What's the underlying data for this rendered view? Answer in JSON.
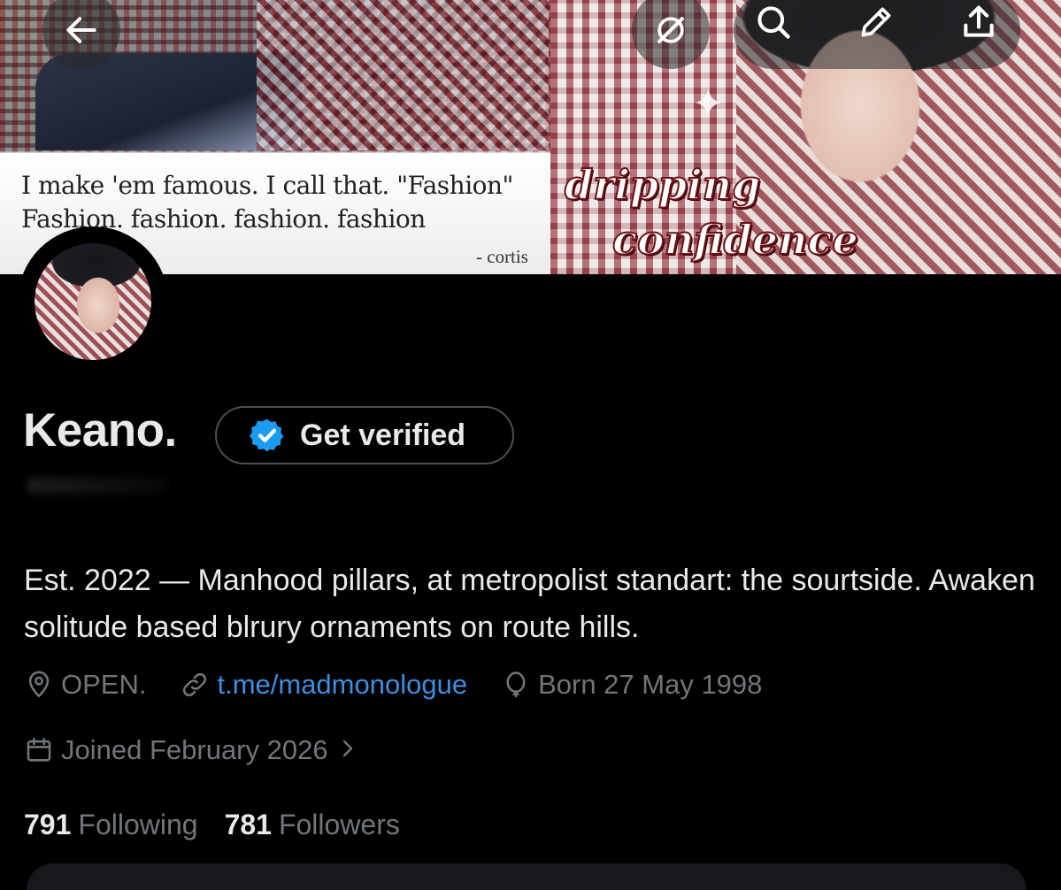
{
  "banner": {
    "quote_line_1": "I make 'em famous. I call that. \"Fashion\"",
    "quote_line_2": "Fashion. fashion. fashion. fashion",
    "attribution": "- cortis",
    "script_line_1": "dripping",
    "script_line_2": "confidence"
  },
  "top_bar": {
    "back_icon": "arrow-left-icon",
    "grok_icon": "grok-icon",
    "search_icon": "search-icon",
    "edit_icon": "pencil-icon",
    "share_icon": "share-icon"
  },
  "profile": {
    "name": "Keano.",
    "verify_label": "Get verified",
    "bio": "Est. 2022 — Manhood pillars, at metropolist standart: the sourtside. Awaken solitude based blrury ornaments on route hills.",
    "location": "OPEN.",
    "website": "t.me/madmonologue",
    "birthday": "Born 27 May 1998",
    "joined": "Joined February 2026"
  },
  "stats": {
    "following_count": "791",
    "following_label": "Following",
    "followers_count": "781",
    "followers_label": "Followers"
  },
  "colors": {
    "background": "#000000",
    "text": "#e7e9ea",
    "muted": "#71767b",
    "link": "#3d8fe0",
    "verified_blue": "#1d9bf0"
  }
}
